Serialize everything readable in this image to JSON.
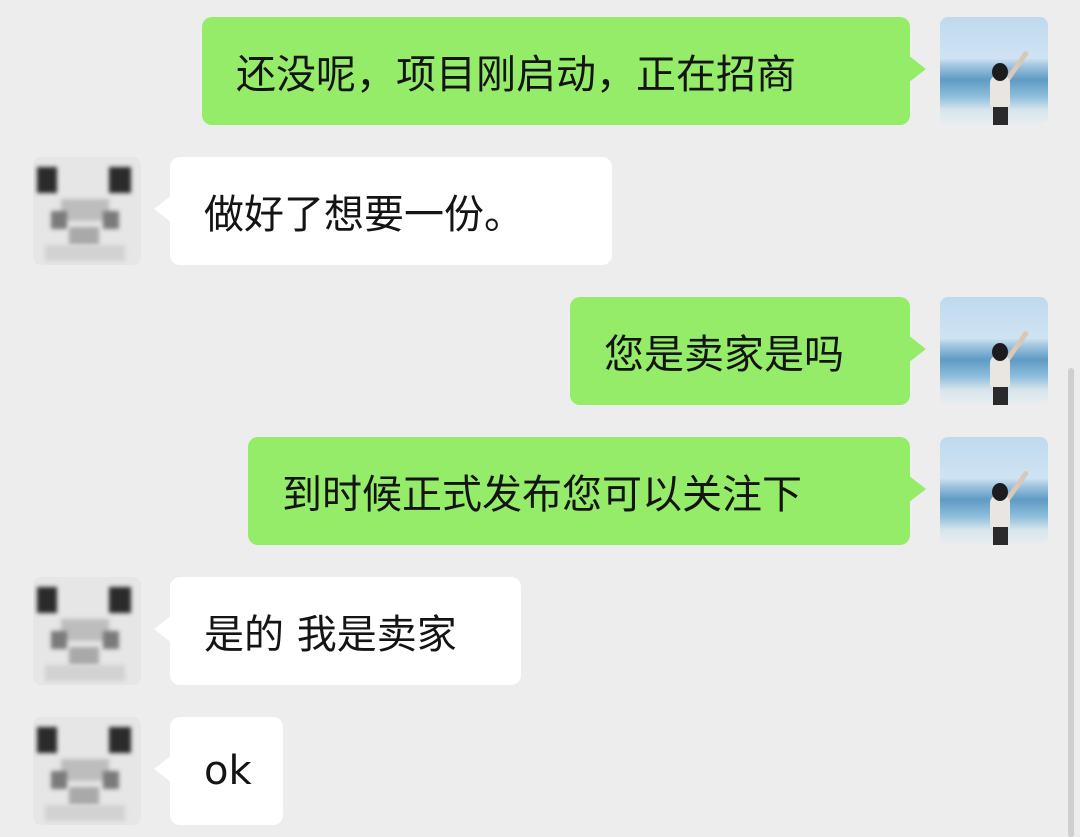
{
  "chat": {
    "messages": [
      {
        "side": "out",
        "text": "还没呢，项目刚启动，正在招商"
      },
      {
        "side": "in",
        "text": "做好了想要一份。"
      },
      {
        "side": "out",
        "text": "您是卖家是吗"
      },
      {
        "side": "out",
        "text": "到时候正式发布您可以关注下"
      },
      {
        "side": "in",
        "text": "是的 我是卖家"
      },
      {
        "side": "in",
        "text": "ok"
      }
    ]
  },
  "colors": {
    "background": "#ededed",
    "outgoing_bubble": "#95ec69",
    "incoming_bubble": "#ffffff"
  },
  "icons": {
    "self_avatar": "beach-photo-avatar",
    "other_avatar": "pixelated-avatar"
  }
}
